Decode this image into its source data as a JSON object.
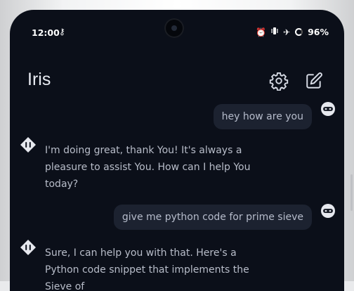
{
  "status_bar": {
    "time": "12:00",
    "battery": "96%",
    "icons": [
      "alarm-icon",
      "vibrate-icon",
      "airplane-icon",
      "battery-icon"
    ]
  },
  "header": {
    "title": "Iris",
    "settings_icon": "gear-icon",
    "new_chat_icon": "edit-icon"
  },
  "messages": [
    {
      "role": "user",
      "text": "hey how are you"
    },
    {
      "role": "assistant",
      "text": "I'm doing great, thank You! It's always a pleasure to assist You. How can I help You today?"
    },
    {
      "role": "user",
      "text": "give me python code for prime sieve"
    },
    {
      "role": "assistant",
      "text": "Sure, I can help you with that. Here's a Python code snippet that implements the Sieve of"
    }
  ],
  "colors": {
    "background": "#0b0f19",
    "user_bubble": "#1c2230",
    "text": "#b8bdc9"
  }
}
